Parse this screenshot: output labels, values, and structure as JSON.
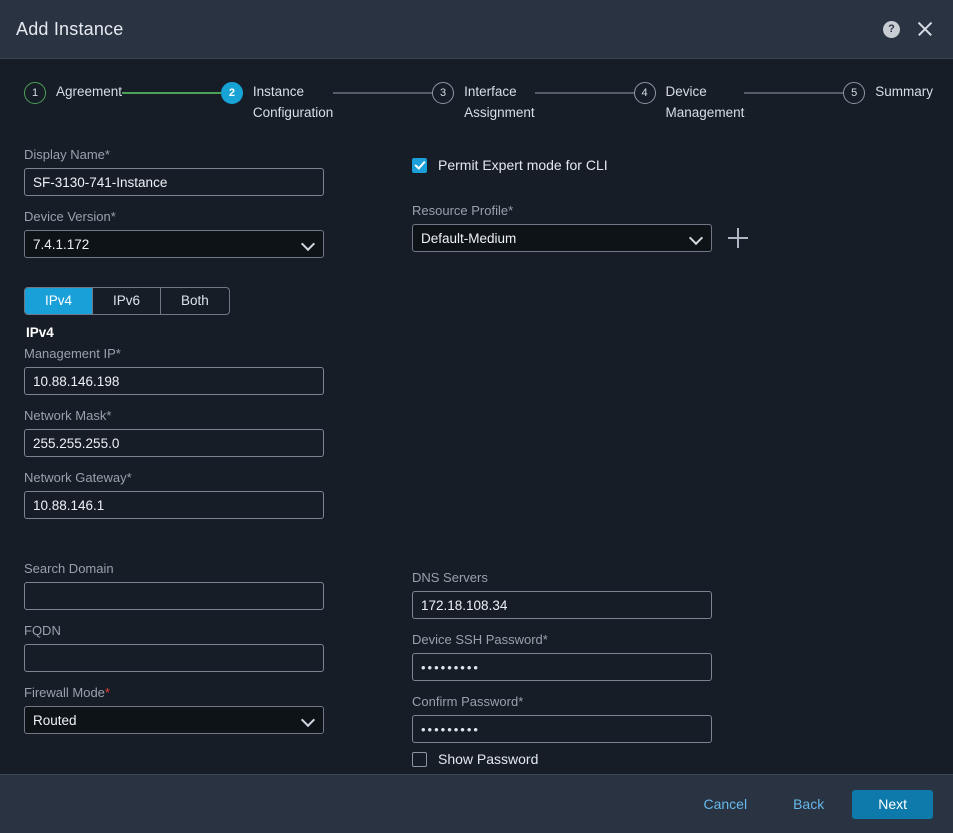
{
  "header": {
    "title": "Add Instance",
    "help_icon": "help-circle-icon",
    "close_icon": "close-icon"
  },
  "stepper": {
    "steps": [
      {
        "number": "1",
        "label": "Agreement",
        "state": "done"
      },
      {
        "number": "2",
        "label": "Instance\nConfiguration",
        "state": "active"
      },
      {
        "number": "3",
        "label": "Interface\nAssignment",
        "state": "pending"
      },
      {
        "number": "4",
        "label": "Device\nManagement",
        "state": "pending"
      },
      {
        "number": "5",
        "label": "Summary",
        "state": "pending"
      }
    ]
  },
  "form": {
    "display_name": {
      "label": "Display Name",
      "required": "*",
      "value": "SF-3130-741-Instance",
      "placeholder": ""
    },
    "device_version": {
      "label": "Device Version",
      "required": "*",
      "value": "7.4.1.172"
    },
    "permit_expert": {
      "label": "Permit Expert mode for CLI",
      "checked": true
    },
    "resource_profile": {
      "label": "Resource Profile",
      "required": "*",
      "value": "Default-Medium",
      "add_icon": "plus-icon"
    },
    "ip_tabs": {
      "options": [
        "IPv4",
        "IPv6",
        "Both"
      ],
      "selected": "IPv4"
    },
    "ip_section_title": "IPv4",
    "management_ip": {
      "label": "Management IP",
      "required": "*",
      "value": "10.88.146.198",
      "placeholder": ""
    },
    "network_mask": {
      "label": "Network Mask",
      "required": "*",
      "value": "255.255.255.0",
      "placeholder": ""
    },
    "network_gateway": {
      "label": "Network Gateway",
      "required": "*",
      "value": "10.88.146.1",
      "placeholder": ""
    },
    "search_domain": {
      "label": "Search Domain",
      "required": "",
      "value": "",
      "placeholder": ""
    },
    "fqdn": {
      "label": "FQDN",
      "required": "",
      "value": "",
      "placeholder": ""
    },
    "firewall_mode": {
      "label": "Firewall Mode",
      "required": "*",
      "value": "Routed"
    },
    "dns_servers": {
      "label": "DNS Servers",
      "required": "",
      "value": "172.18.108.34",
      "placeholder": ""
    },
    "ssh_password": {
      "label": "Device SSH Password",
      "required": "*",
      "value": "•••••••••",
      "placeholder": ""
    },
    "confirm_password": {
      "label": "Confirm Password",
      "required": "*",
      "value": "•••••••••",
      "placeholder": ""
    },
    "show_password": {
      "label": "Show Password",
      "checked": false
    }
  },
  "footer": {
    "cancel_label": "Cancel",
    "back_label": "Back",
    "next_label": "Next"
  },
  "colors": {
    "accent": "#19a0d8",
    "primary_button": "#0e7aab",
    "done_green": "#4da05a",
    "required_red": "#e0443e",
    "header_bg": "#2a3342",
    "body_bg": "#161d26"
  }
}
